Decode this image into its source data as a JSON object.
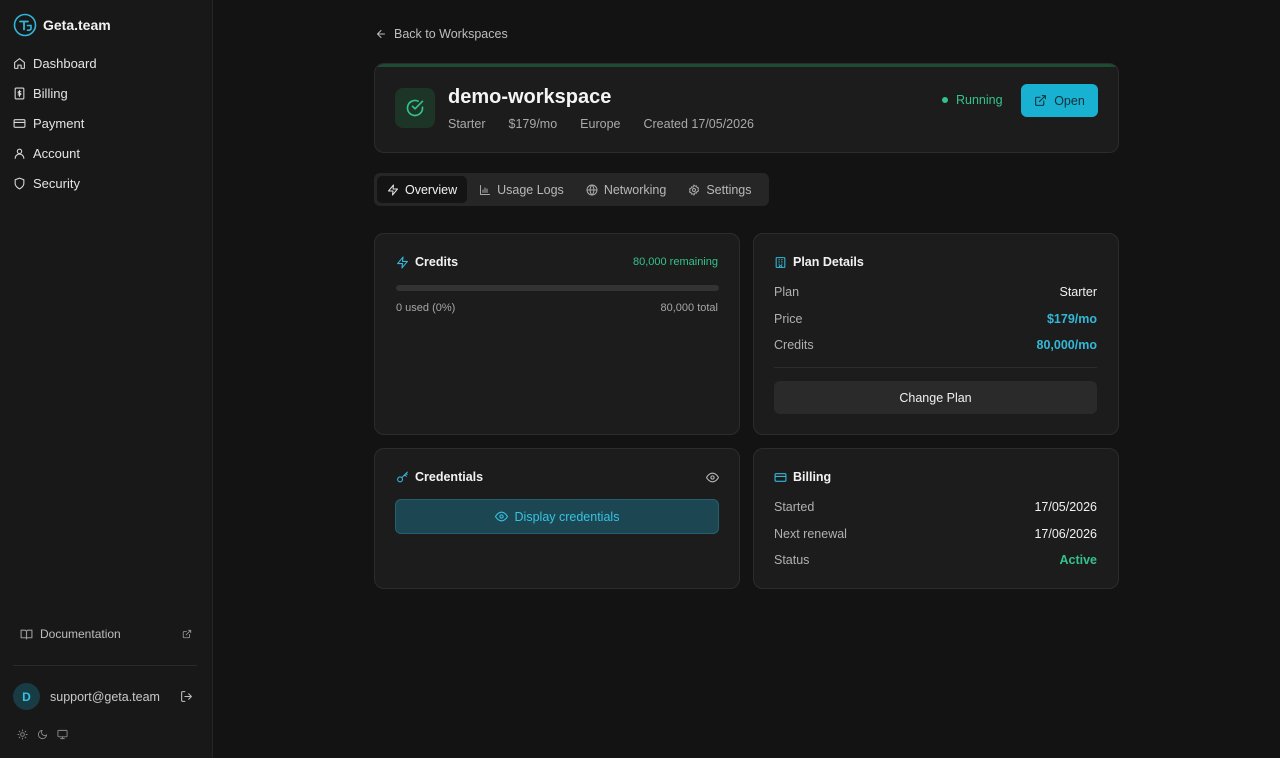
{
  "brand": {
    "name": "Geta.team",
    "logo_icon": "geta-logo-icon"
  },
  "sidebar": {
    "items": [
      {
        "label": "Dashboard",
        "icon": "home-icon"
      },
      {
        "label": "Billing",
        "icon": "receipt-icon"
      },
      {
        "label": "Payment",
        "icon": "credit-card-icon"
      },
      {
        "label": "Account",
        "icon": "user-icon"
      },
      {
        "label": "Security",
        "icon": "shield-icon"
      }
    ],
    "documentation_label": "Documentation",
    "user": {
      "initial": "D",
      "email": "support@geta.team"
    }
  },
  "back_label": "Back to Workspaces",
  "workspace": {
    "name": "demo-workspace",
    "plan": "Starter",
    "price": "$179/mo",
    "region": "Europe",
    "created": "Created 17/05/2026",
    "status": "Running",
    "open_label": "Open"
  },
  "tabs": [
    {
      "label": "Overview",
      "icon": "zap-icon",
      "active": true
    },
    {
      "label": "Usage Logs",
      "icon": "bar-chart-icon",
      "active": false
    },
    {
      "label": "Networking",
      "icon": "globe-icon",
      "active": false
    },
    {
      "label": "Settings",
      "icon": "gear-icon",
      "active": false
    }
  ],
  "credits": {
    "title": "Credits",
    "remaining": "80,000 remaining",
    "used": "0 used (0%)",
    "total": "80,000 total",
    "used_fraction": 0
  },
  "plan_details": {
    "title": "Plan Details",
    "rows": [
      {
        "key": "Plan",
        "value": "Starter"
      },
      {
        "key": "Price",
        "value": "$179/mo"
      },
      {
        "key": "Credits",
        "value": "80,000/mo"
      }
    ],
    "change_plan_label": "Change Plan"
  },
  "credentials": {
    "title": "Credentials",
    "display_label": "Display credentials"
  },
  "billing": {
    "title": "Billing",
    "rows": [
      {
        "key": "Started",
        "value": "17/05/2026"
      },
      {
        "key": "Next renewal",
        "value": "17/06/2026"
      },
      {
        "key": "Status",
        "value": "Active"
      }
    ]
  },
  "colors": {
    "background": "#131313",
    "sidebar": "#181818",
    "accent": "#19b1d2",
    "success": "#34c28a"
  }
}
